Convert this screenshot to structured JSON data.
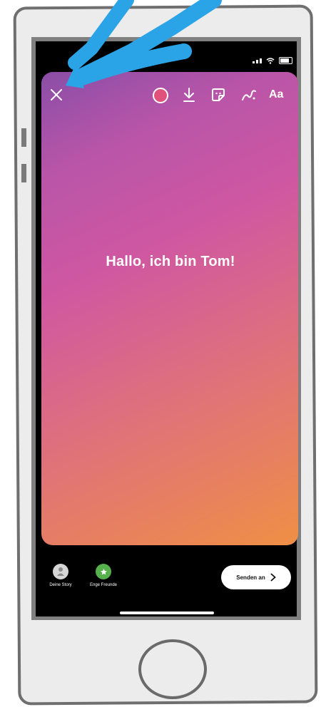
{
  "status_bar": {
    "signal_icon": "signal-icon",
    "wifi_icon": "wifi-icon",
    "battery_icon": "battery-icon"
  },
  "toolbar": {
    "close_icon": "close-icon",
    "color_icon": "color-picker-icon",
    "download_icon": "download-icon",
    "sticker_icon": "sticker-icon",
    "draw_icon": "draw-icon",
    "text_label": "Aa"
  },
  "story": {
    "text": "Hallo, ich bin Tom!"
  },
  "bottom_bar": {
    "audiences": [
      {
        "label": "Deine Story",
        "icon": "avatar-icon"
      },
      {
        "label": "Enge Freunde",
        "icon": "star-icon"
      }
    ],
    "send_label": "Senden an"
  },
  "colors": {
    "gradient_top": "#8a4ea7",
    "gradient_mid": "#cf57a2",
    "gradient_bottom": "#ef8f45",
    "close_friends_green": "#56b04b",
    "annotation_arrow": "#2aa4e6"
  }
}
